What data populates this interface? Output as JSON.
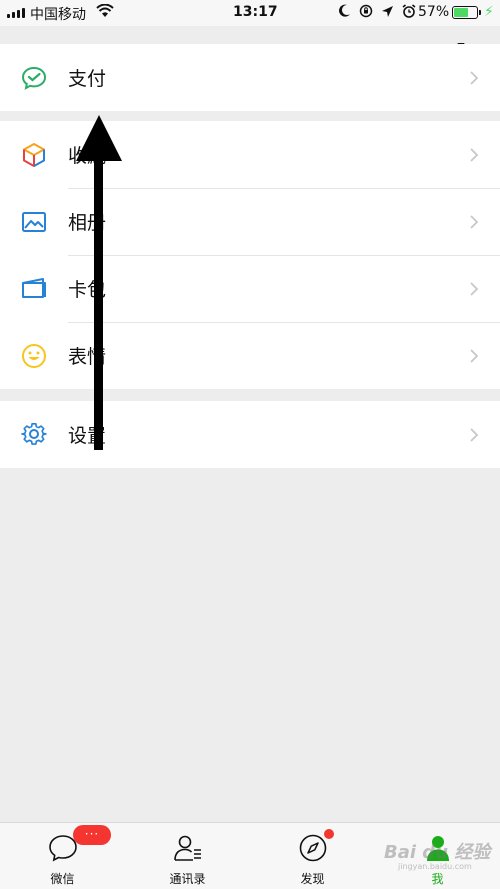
{
  "status_bar": {
    "carrier": "中国移动",
    "time": "13:17",
    "battery": "57%"
  },
  "colors": {
    "accent_green": "#1aad19",
    "badge_red": "#f43530",
    "pay_green": "#2aae67",
    "icon_blue": "#2782d7",
    "emoji_yellow": "#f7c51c"
  },
  "menu": {
    "pay": {
      "label": "支付",
      "icon": "wechat-pay-icon"
    },
    "favorites": {
      "label": "收藏",
      "icon": "cube-icon"
    },
    "album": {
      "label": "相册",
      "icon": "picture-icon"
    },
    "cards": {
      "label": "卡包",
      "icon": "card-icon"
    },
    "stickers": {
      "label": "表情",
      "icon": "smiley-icon"
    },
    "settings": {
      "label": "设置",
      "icon": "gear-icon"
    }
  },
  "tabbar": {
    "chats": {
      "label": "微信",
      "badge": "···"
    },
    "contacts": {
      "label": "通讯录"
    },
    "discover": {
      "label": "发现"
    },
    "me": {
      "label": "我"
    }
  },
  "watermark": {
    "text": "Bai du 经验",
    "sub": "jingyan.baidu.com"
  }
}
